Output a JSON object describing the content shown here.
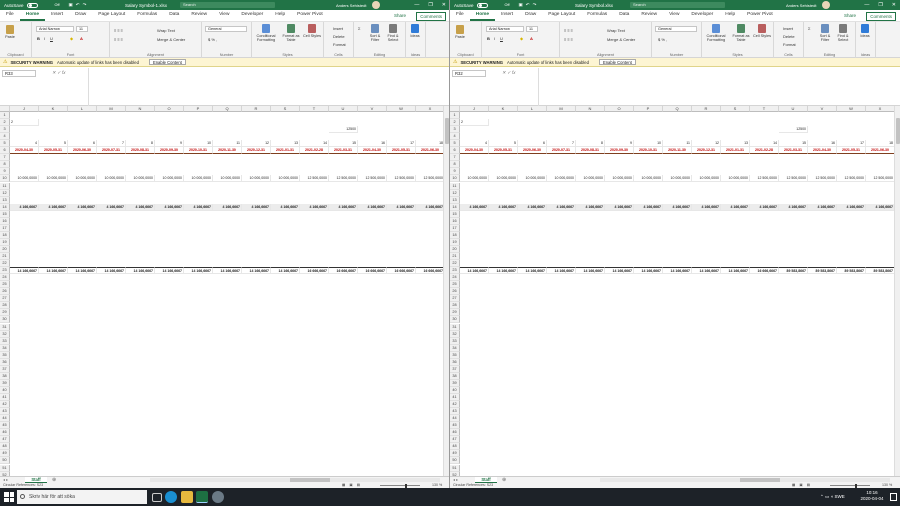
{
  "title_bar": {
    "autosave_label": "AutoSave",
    "toggle_state": "Off",
    "search_placeholder": "Search",
    "user_name": "Anders Sehlstedt",
    "minimize": "—",
    "restore": "❐",
    "close": "✕"
  },
  "menu": [
    "File",
    "Home",
    "Insert",
    "Draw",
    "Page Layout",
    "Formulas",
    "Data",
    "Review",
    "View",
    "Developer",
    "Help",
    "Power Pivot"
  ],
  "active_tab": "Home",
  "share_label": "Share",
  "comments_label": "Comments",
  "ribbon": {
    "paste": "Paste",
    "clipboard": "Clipboard",
    "font_name": "Arial Narrow",
    "font_size": "11",
    "font": "Font",
    "wrap_text": "Wrap Text",
    "merge_center": "Merge & Center",
    "alignment": "Alignment",
    "number_format": "General",
    "number": "Number",
    "conditional_formatting": "Conditional Formatting",
    "format_as_table": "Format as Table",
    "cell_styles": "Cell Styles",
    "styles": "Styles",
    "insert": "Insert",
    "delete": "Delete",
    "format": "Format",
    "cells": "Cells",
    "sort_filter": "Sort & Filter",
    "find_select": "Find & Select",
    "editing": "Editing",
    "ideas": "Ideas"
  },
  "security": {
    "title": "SECURITY WARNING",
    "message": "Automatic update of links has been disabled",
    "button": "Enable Content"
  },
  "windows": [
    {
      "doc_title": "Salary Symbol-1.xlsx",
      "name_box": "R33",
      "row3_value": "12500",
      "row8": [
        "10 000,0000",
        "10 000,0000",
        "10 000,0000",
        "10 000,0000",
        "10 000,0000",
        "10 000,0000",
        "10 000,0000",
        "10 000,0000",
        "10 000,0000",
        "10 000,0000",
        "12 500,0000",
        "12 500,0000",
        "12 500,0000",
        "12 500,0000",
        "12 500,0000"
      ],
      "row23": [
        "14 166,6667",
        "14 166,6667",
        "14 166,6667",
        "14 166,6667",
        "14 166,6667",
        "14 166,6667",
        "14 166,6667",
        "14 166,6667",
        "14 166,6667",
        "14 166,6667",
        "16 666,6667",
        "16 666,6667",
        "16 666,6667",
        "16 666,6667",
        "16 666,6667"
      ]
    },
    {
      "doc_title": "Salary Symbol.xlsx",
      "name_box": "R32",
      "row3_value": "12500",
      "row8": [
        "10 000,0000",
        "10 000,0000",
        "10 000,0000",
        "10 000,0000",
        "10 000,0000",
        "10 000,0000",
        "10 000,0000",
        "10 000,0000",
        "10 000,0000",
        "10 000,0000",
        "12 500,0000",
        "12 500,0000",
        "12 500,0000",
        "12 500,0000",
        "12 500,0000"
      ],
      "row23": [
        "14 166,6667",
        "14 166,6667",
        "14 166,6667",
        "14 166,6667",
        "14 166,6667",
        "14 166,6667",
        "14 166,6667",
        "14 166,6667",
        "14 166,6667",
        "14 166,6667",
        "16 666,6667",
        "89 583,8667",
        "89 583,8667",
        "89 583,8667",
        "89 583,8667"
      ]
    }
  ],
  "grid": {
    "columns": [
      "J",
      "K",
      "L",
      "M",
      "N",
      "O",
      "P",
      "Q",
      "R",
      "S",
      "T",
      "U",
      "V",
      "W",
      "X"
    ],
    "row_numbers": [
      "1",
      "2",
      "3",
      "4",
      "5",
      "6",
      "7",
      "8",
      "9",
      "10",
      "11",
      "12",
      "13",
      "14",
      "15",
      "16",
      "17",
      "18",
      "19",
      "20",
      "21",
      "22",
      "23",
      "24",
      "25",
      "26",
      "27",
      "28",
      "29",
      "30",
      "31",
      "32",
      "33",
      "34",
      "35",
      "36",
      "37",
      "38",
      "39",
      "40",
      "41",
      "42",
      "43",
      "44",
      "45",
      "46",
      "47",
      "48",
      "49",
      "50",
      "51",
      "52"
    ],
    "row2_value": "2",
    "row5": [
      "4",
      "5",
      "6",
      "7",
      "8",
      "9",
      "10",
      "11",
      "12",
      "13",
      "14",
      "15",
      "16",
      "17",
      "18"
    ],
    "dates": [
      "2020-04-30",
      "2020-05-31",
      "2020-06-30",
      "2020-07-31",
      "2020-08-31",
      "2020-09-30",
      "2020-10-31",
      "2020-11-30",
      "2020-12-31",
      "2021-01-31",
      "2021-02-28",
      "2021-03-31",
      "2021-04-30",
      "2021-05-31",
      "2021-06-30"
    ],
    "row11": [
      "4 166,6667",
      "4 166,6667",
      "4 166,6667",
      "4 166,6667",
      "4 166,6667",
      "4 166,6667",
      "4 166,6667",
      "4 166,6667",
      "4 166,6667",
      "4 166,6667",
      "4 166,6667",
      "4 166,6667",
      "4 166,6667",
      "4 166,6667",
      "4 166,6667"
    ]
  },
  "sheet_tab": "Staff",
  "status_left": "Circular References: S23",
  "zoom": "130 %",
  "taskbar": {
    "search": "Skriv här för att söka",
    "lang": "SWE",
    "time": "10:16",
    "date": "2020-04-04"
  },
  "colors": {
    "excel_green": "#217346",
    "date_red": "#c00000",
    "warning_bg": "#fdf5d3"
  }
}
